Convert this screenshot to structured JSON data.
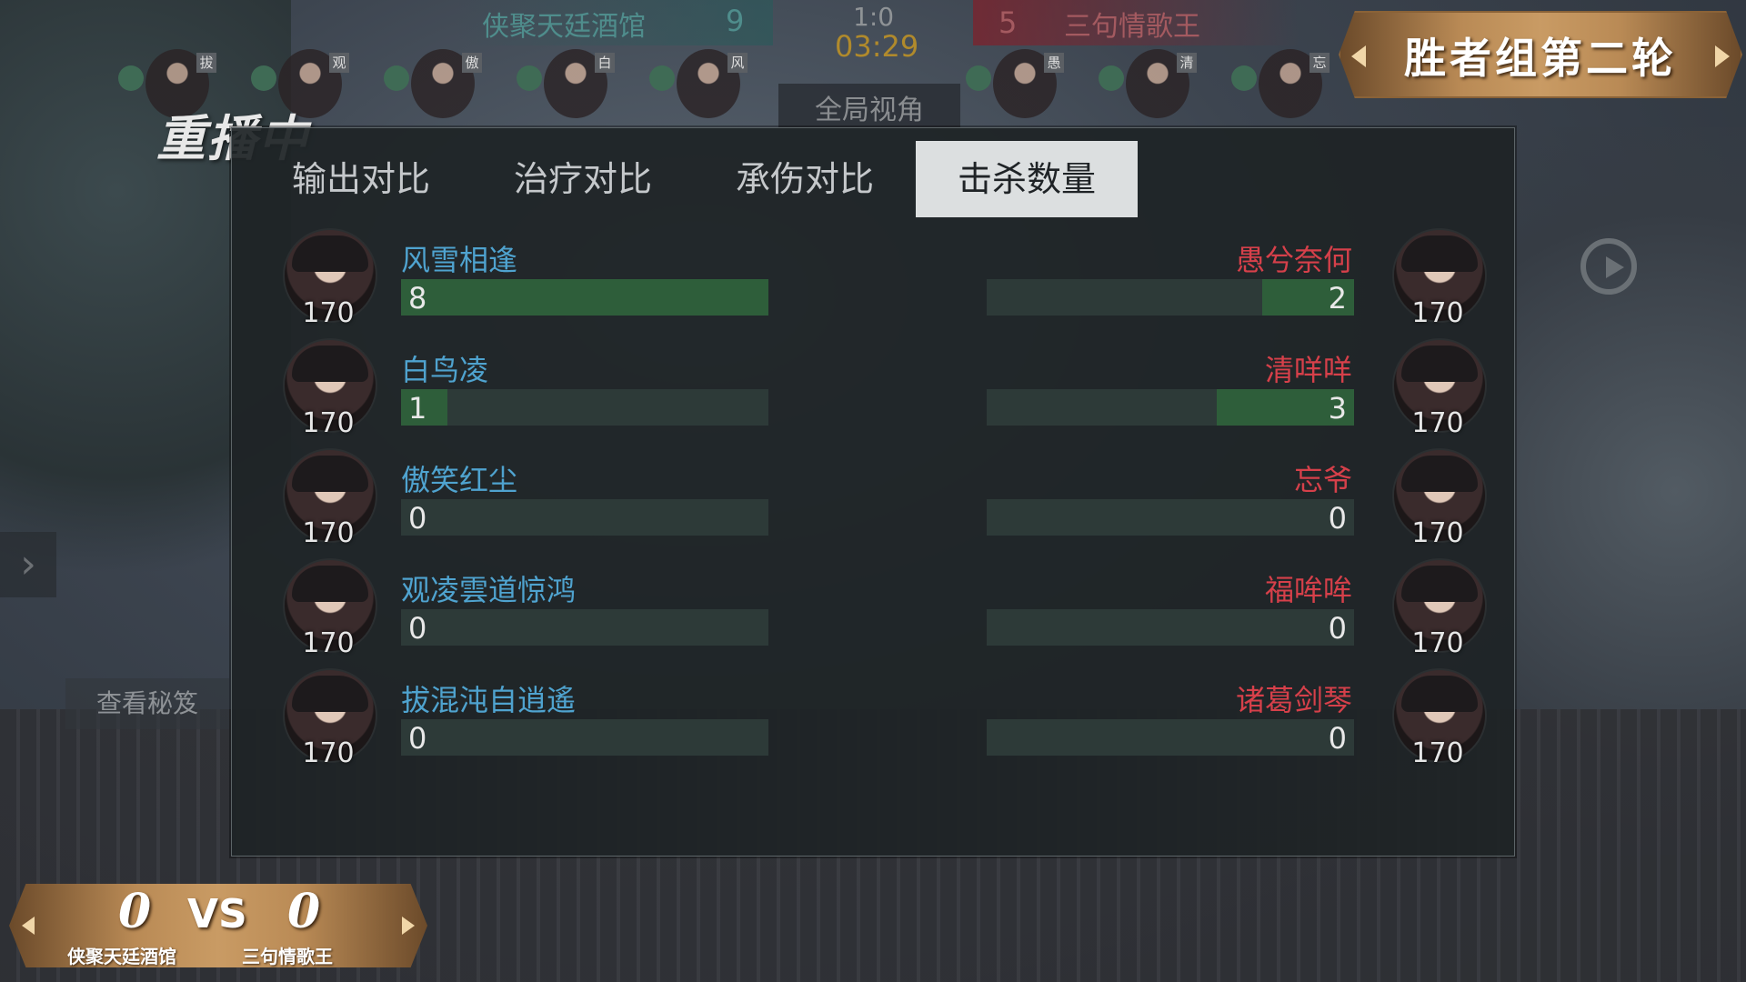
{
  "scoreboard": {
    "left_team": "侠聚天廷酒馆",
    "left_score": "9",
    "match_score": "1:0",
    "timer": "03:29",
    "right_score": "5",
    "right_team": "三句情歌王",
    "view_all_label": "全局视角",
    "left_units": [
      {
        "tag": "拔",
        "icon": "portrait-icon"
      },
      {
        "tag": "观",
        "icon": "portrait-icon"
      },
      {
        "tag": "傲",
        "icon": "portrait-icon"
      },
      {
        "tag": "白",
        "icon": "portrait-icon"
      },
      {
        "tag": "风",
        "icon": "portrait-icon"
      }
    ],
    "right_units": [
      {
        "tag": "愚",
        "icon": "portrait-icon"
      },
      {
        "tag": "清",
        "icon": "portrait-icon"
      },
      {
        "tag": "忘",
        "icon": "portrait-icon"
      }
    ]
  },
  "replay_label": "重播中",
  "round_banner": "胜者组第二轮",
  "tabs": [
    {
      "label": "输出对比",
      "active": false
    },
    {
      "label": "治疗对比",
      "active": false
    },
    {
      "label": "承伤对比",
      "active": false
    },
    {
      "label": "击杀数量",
      "active": true
    }
  ],
  "max_kills": 8,
  "left_players": [
    {
      "name": "风雪相逢",
      "level": "170",
      "value": "8",
      "kills": 8
    },
    {
      "name": "白鸟凌",
      "level": "170",
      "value": "1",
      "kills": 1
    },
    {
      "name": "傲笑红尘",
      "level": "170",
      "value": "0",
      "kills": 0
    },
    {
      "name": "观凌雲道惊鸿",
      "level": "170",
      "value": "0",
      "kills": 0
    },
    {
      "name": "拔混沌自逍遙",
      "level": "170",
      "value": "0",
      "kills": 0
    }
  ],
  "right_players": [
    {
      "name": "愚兮奈何",
      "level": "170",
      "value": "2",
      "kills": 2
    },
    {
      "name": "清咩咩",
      "level": "170",
      "value": "3",
      "kills": 3
    },
    {
      "name": "忘爷",
      "level": "170",
      "value": "0",
      "kills": 0
    },
    {
      "name": "福哞哞",
      "level": "170",
      "value": "0",
      "kills": 0
    },
    {
      "name": "诸葛剑琴",
      "level": "170",
      "value": "0",
      "kills": 0
    }
  ],
  "side": {
    "expand_icon": "chevron-right-icon",
    "view_secrets_label": "查看秘笈",
    "exit_icon": "exit-icon"
  },
  "vs_banner": {
    "left_score": "0",
    "vs": "VS",
    "right_score": "0",
    "left_name": "侠聚天廷酒馆",
    "right_name": "三句情歌王"
  },
  "colors": {
    "left_name": "#4fa3cf",
    "right_name": "#d6404a",
    "bar_fill": "#2e5e3a",
    "bar_track": "#2d3a38",
    "timer": "#b08a2c"
  }
}
